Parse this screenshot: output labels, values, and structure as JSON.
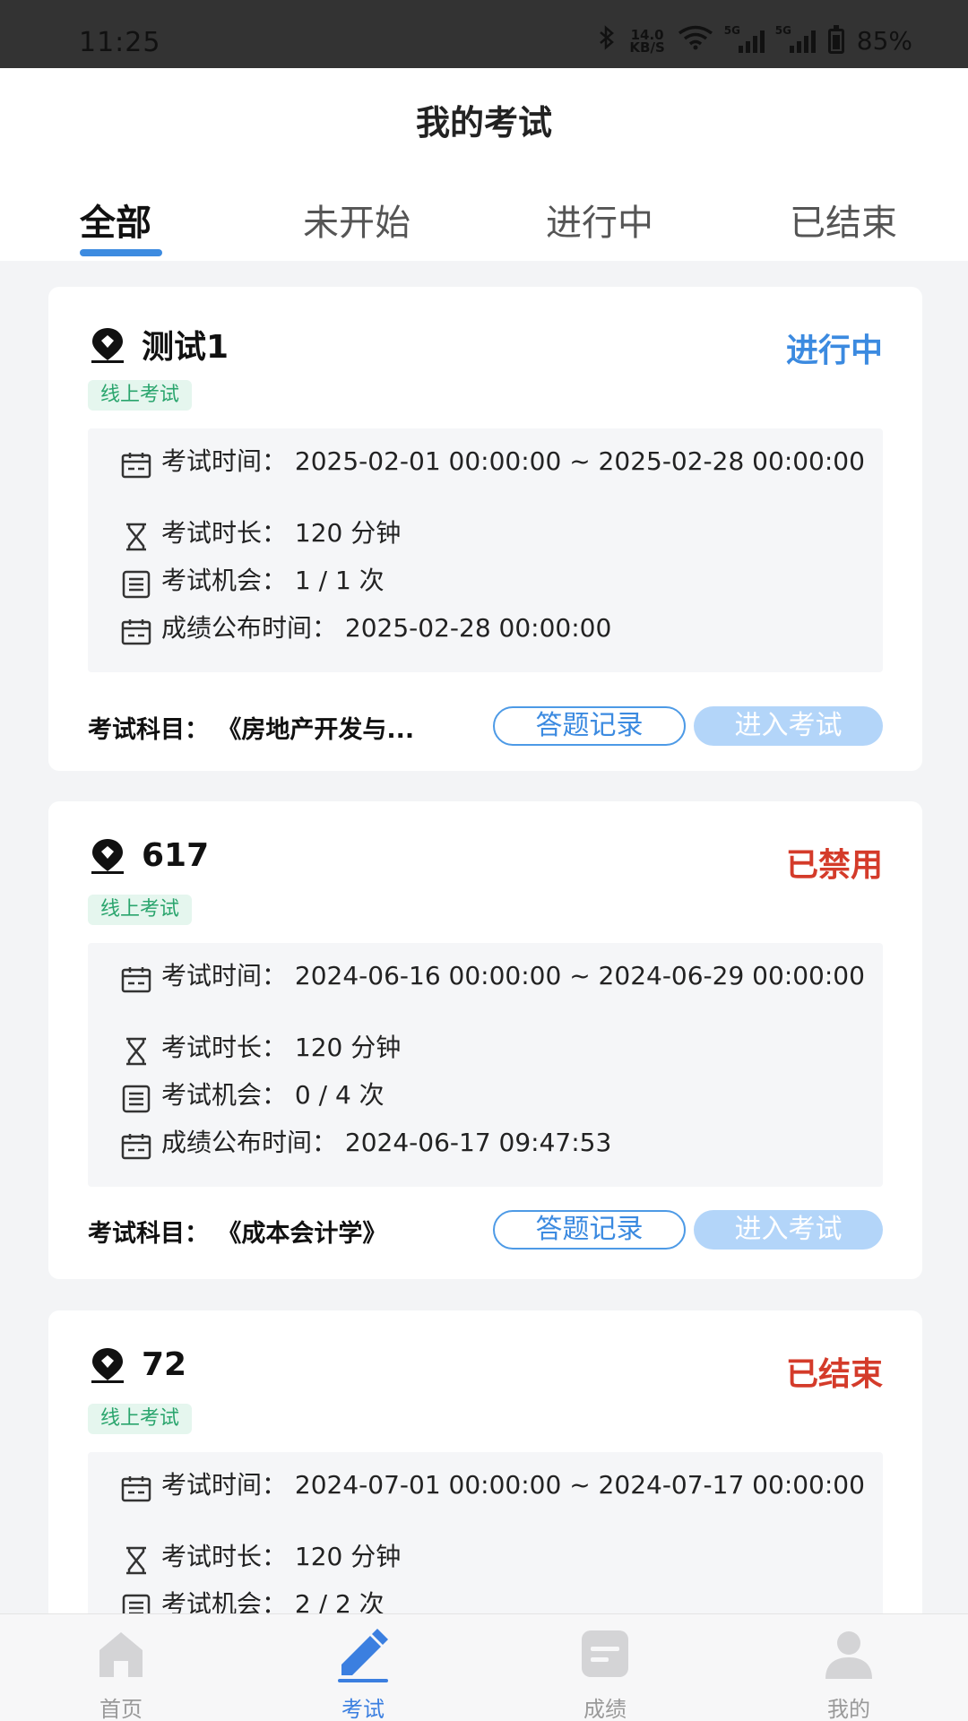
{
  "status_bar": {
    "time": "11:25",
    "net_speed_value": "14.0",
    "net_speed_unit": "KB/S",
    "signal1_label": "5G",
    "signal2_label": "5G",
    "battery": "85%"
  },
  "header": {
    "title": "我的考试",
    "tabs": [
      {
        "label": "全部",
        "active": true
      },
      {
        "label": "未开始",
        "active": false
      },
      {
        "label": "进行中",
        "active": false
      },
      {
        "label": "已结束",
        "active": false
      }
    ]
  },
  "exams": [
    {
      "name": "测试1",
      "status": "进行中",
      "status_color": "#3b8ae0",
      "tag": "线上考试",
      "time_label": "考试时间：",
      "time_value": "2025-02-01 00:00:00 ~ 2025-02-28 00:00:00",
      "duration_label": "考试时长：",
      "duration_value": "120 分钟",
      "chances_label": "考试机会：",
      "chances_value": "1 / 1 次",
      "publish_label": "成绩公布时间：",
      "publish_value": "2025-02-28 00:00:00",
      "subject": "考试科目：  《房地产开发与...",
      "record_button": "答题记录",
      "enter_button": "进入考试"
    },
    {
      "name": "617",
      "status": "已禁用",
      "status_color": "#d43b2a",
      "tag": "线上考试",
      "time_label": "考试时间：",
      "time_value": "2024-06-16 00:00:00 ~ 2024-06-29 00:00:00",
      "duration_label": "考试时长：",
      "duration_value": "120 分钟",
      "chances_label": "考试机会：",
      "chances_value": "0 / 4 次",
      "publish_label": "成绩公布时间：",
      "publish_value": "2024-06-17 09:47:53",
      "subject": "考试科目：  《成本会计学》",
      "record_button": "答题记录",
      "enter_button": "进入考试"
    },
    {
      "name": "72",
      "status": "已结束",
      "status_color": "#d43b2a",
      "tag": "线上考试",
      "time_label": "考试时间：",
      "time_value": "2024-07-01 00:00:00 ~ 2024-07-17 00:00:00",
      "duration_label": "考试时长：",
      "duration_value": "120 分钟",
      "chances_label": "考试机会：",
      "chances_value": "2 / 2 次"
    }
  ],
  "bottom_nav": [
    {
      "label": "首页",
      "icon": "home-icon",
      "active": false
    },
    {
      "label": "考试",
      "icon": "pen-icon",
      "active": true
    },
    {
      "label": "成绩",
      "icon": "score-icon",
      "active": false
    },
    {
      "label": "我的",
      "icon": "user-icon",
      "active": false
    }
  ]
}
